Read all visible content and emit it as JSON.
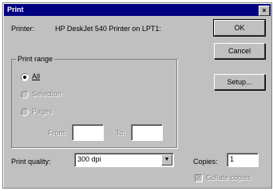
{
  "window": {
    "title": "Print",
    "close_glyph": "×"
  },
  "printer": {
    "label": "Printer:",
    "value": "HP DeskJet 540 Printer on LPT1:"
  },
  "buttons": {
    "ok": "OK",
    "cancel": "Cancel",
    "setup": "Setup..."
  },
  "print_range": {
    "title": "Print range",
    "all": "All",
    "selection": "Selection",
    "pages": "Pages",
    "from_label": "From:",
    "to_label": "To:",
    "from_value": "",
    "to_value": "",
    "selected": "all"
  },
  "print_quality": {
    "label": "Print quality:",
    "value": "300 dpi",
    "dropdown_glyph": "▼"
  },
  "copies": {
    "label": "Copies:",
    "value": "1"
  },
  "collate": {
    "label": "Collate copies",
    "checked": true,
    "check_glyph": "✓"
  },
  "colors": {
    "face": "#c0c0c0",
    "title_bar": "#000080",
    "disabled": "#808080"
  }
}
